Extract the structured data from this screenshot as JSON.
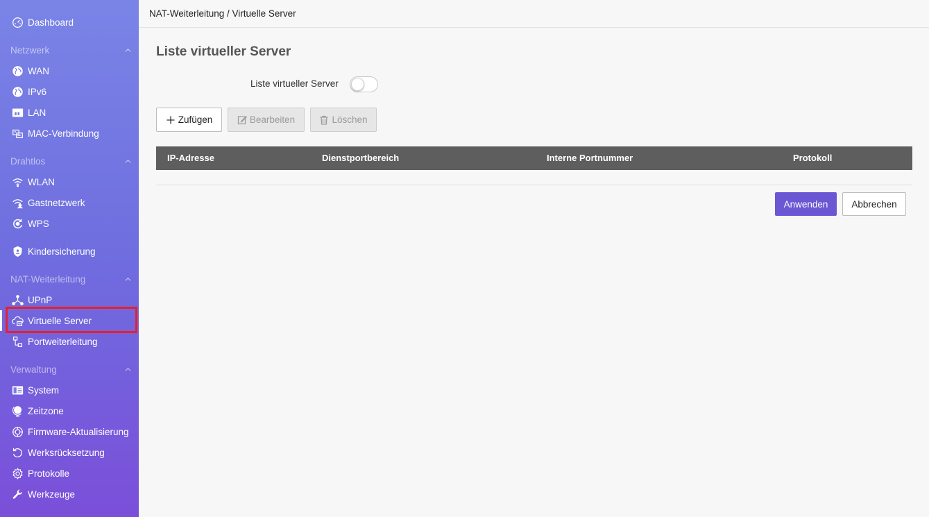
{
  "breadcrumb": "NAT-Weiterleitung / Virtuelle Server",
  "sidebar": {
    "dashboard": "Dashboard",
    "sections": {
      "netzwerk": "Netzwerk",
      "drahtlos": "Drahtlos",
      "nat": "NAT-Weiterleitung",
      "verwaltung": "Verwaltung"
    },
    "items": {
      "wan": "WAN",
      "ipv6": "IPv6",
      "lan": "LAN",
      "mac": "MAC-Verbindung",
      "wlan": "WLAN",
      "gast": "Gastnetzwerk",
      "wps": "WPS",
      "kinder": "Kindersicherung",
      "upnp": "UPnP",
      "virtuell": "Virtuelle Server",
      "portweiter": "Portweiterleitung",
      "system": "System",
      "zeitzone": "Zeitzone",
      "firmware": "Firmware-Aktualisierung",
      "werks": "Werksrücksetzung",
      "protokolle": "Protokolle",
      "werkzeuge": "Werkzeuge"
    }
  },
  "main": {
    "title": "Liste virtueller Server",
    "toggle_label": "Liste virtueller Server",
    "toggle_on": false,
    "buttons": {
      "add": "Zufügen",
      "edit": "Bearbeiten",
      "delete": "Löschen"
    },
    "table": {
      "columns": [
        "IP-Adresse",
        "Dienstportbereich",
        "Interne Portnummer",
        "Protokoll"
      ],
      "rows": []
    },
    "apply": "Anwenden",
    "cancel": "Abbrechen"
  },
  "colors": {
    "accent": "#6b56d3",
    "highlight": "#e8202a",
    "table_header": "#5e5e5e"
  }
}
